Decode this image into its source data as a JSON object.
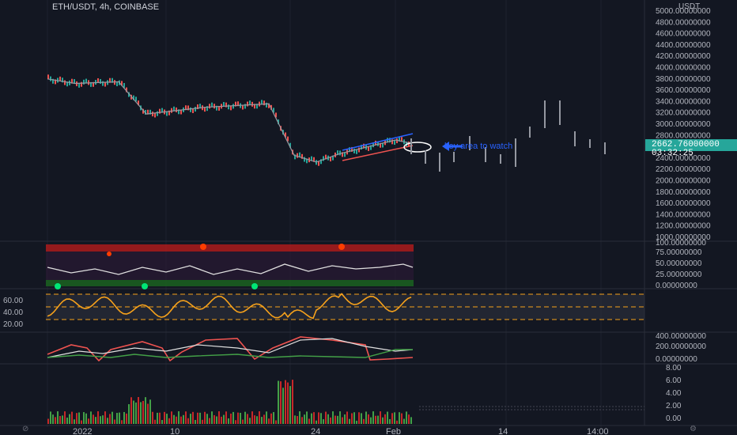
{
  "header": {
    "symbol_line": "ETH/USDT, 4h, COINBASE",
    "currency": "USDT"
  },
  "price_axis": {
    "ticks": [
      "5000.00000000",
      "4800.00000000",
      "4600.00000000",
      "4400.00000000",
      "4200.00000000",
      "4000.00000000",
      "3800.00000000",
      "3600.00000000",
      "3400.00000000",
      "3200.00000000",
      "3000.00000000",
      "2800.00000000",
      "2600.00000000",
      "2400.00000000",
      "2200.00000000",
      "2000.00000000",
      "1800.00000000",
      "1600.00000000",
      "1400.00000000",
      "1200.00000000",
      "1000.00000000"
    ],
    "current_price": "2662.76000000",
    "countdown": "03:32:25"
  },
  "annotation": {
    "text": "key area to watch",
    "color": "#2962ff"
  },
  "osc1_axis": [
    "100.00000000",
    "75.00000000",
    "50.00000000",
    "25.00000000",
    "0.00000000"
  ],
  "rsi_axis": [
    "60.00",
    "40.00",
    "20.00"
  ],
  "osc3_axis": [
    "400.00000000",
    "200.00000000",
    "0.00000000"
  ],
  "vol_axis": [
    "8.00",
    "6.00",
    "4.00",
    "2.00",
    "0.00"
  ],
  "time_axis": [
    "2022",
    "10",
    "24",
    "Feb",
    "14",
    "14:00"
  ],
  "nav": {
    "left_btn": "⊘",
    "right_btn": "⚙"
  },
  "colors": {
    "background": "#131722",
    "up": "#26a69a",
    "down": "#ef5350",
    "rsi": "#f7a21b",
    "accent": "#2962ff"
  },
  "chart_data": {
    "type": "line",
    "title": "ETH/USDT, 4h, COINBASE",
    "ylabel": "USDT",
    "ylim": [
      1000,
      5000
    ],
    "x": [
      "2022",
      "10",
      "24",
      "Feb",
      "14",
      "14:00"
    ],
    "series": [
      {
        "name": "ETH/USDT",
        "values": [
          3800,
          3720,
          3750,
          3180,
          3300,
          3360,
          2450,
          2330,
          2480,
          2720,
          2662
        ]
      }
    ],
    "annotations": [
      "key area to watch"
    ]
  }
}
